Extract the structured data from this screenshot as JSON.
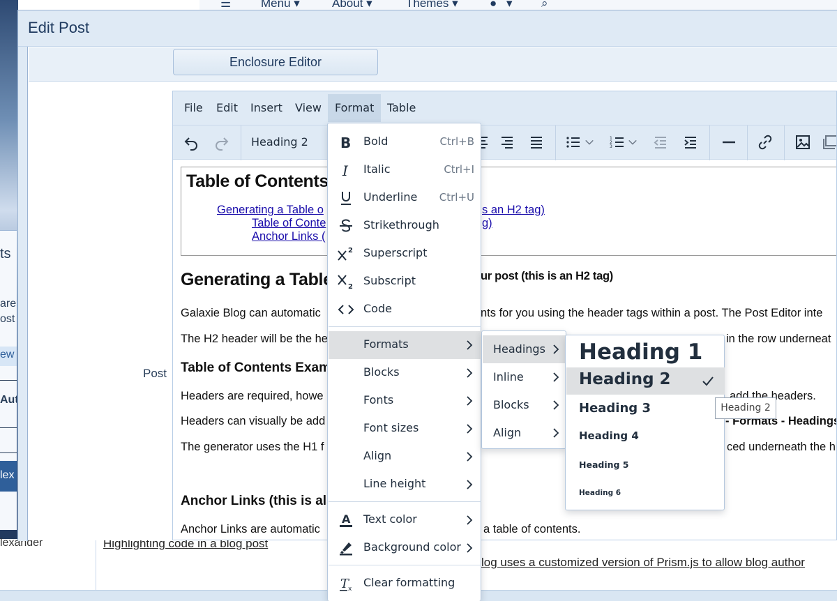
{
  "background": {
    "nav": {
      "menu": "Menu ▾",
      "about": "About ▾",
      "themes": "Themes ▾",
      "user": "▾"
    },
    "left_fragments": [
      "ts",
      "are",
      "ost",
      "ew l",
      "Aut",
      "lex"
    ],
    "author": "lexander",
    "link1": "Highlighting code in a blog post",
    "link2": "log uses a customized version of Prism.js to allow blog author"
  },
  "dialog": {
    "title": "Edit Post",
    "enclosure_button": "Enclosure Editor",
    "post_label": "Post"
  },
  "editor": {
    "menubar": [
      "File",
      "Edit",
      "Insert",
      "View",
      "Format",
      "Table"
    ],
    "active_menu": "Format",
    "toolbar": {
      "block_format": "Heading 2"
    },
    "content": {
      "toc_title": "Table of Contents",
      "toc_links": [
        "Generating a Table o",
        "s an H2 tag)",
        "Table of Conte",
        "g)",
        "Anchor Links ("
      ],
      "h2_1_a": "Generating a Table",
      "h2_1_b": "ur post (this is an H2 tag)",
      "p1_a": "Galaxie Blog can automatic",
      "p1_b": "nts for you using the header tags within a post. The Post Editor inte",
      "p2_a": "The H2 header will be the he",
      "p2_b": "in the row underneat",
      "h3_1": "Table of Contents Exam",
      "p3_a": "Headers are required, howe",
      "p3_b": "add the headers.",
      "p4_a": "Headers can visually be add",
      "p4_b": "- Formats -  Headings",
      "p5_a": "The generator uses the H1 f",
      "p5_b": "ced underneath the h",
      "h3_2": "Anchor Links (this is als",
      "p6_a": "Anchor Links are automatic",
      "p6_b": "a table of contents."
    }
  },
  "format_menu": {
    "items": [
      {
        "label": "Bold",
        "shortcut": "Ctrl+B"
      },
      {
        "label": "Italic",
        "shortcut": "Ctrl+I"
      },
      {
        "label": "Underline",
        "shortcut": "Ctrl+U"
      },
      {
        "label": "Strikethrough"
      },
      {
        "label": "Superscript"
      },
      {
        "label": "Subscript"
      },
      {
        "label": "Code"
      },
      {
        "label": "Formats"
      },
      {
        "label": "Blocks"
      },
      {
        "label": "Fonts"
      },
      {
        "label": "Font sizes"
      },
      {
        "label": "Align"
      },
      {
        "label": "Line height"
      },
      {
        "label": "Text color"
      },
      {
        "label": "Background color"
      },
      {
        "label": "Clear formatting"
      }
    ],
    "active": "Formats"
  },
  "formats_menu": {
    "items": [
      "Headings",
      "Inline",
      "Blocks",
      "Align"
    ],
    "active": "Headings"
  },
  "headings_menu": {
    "items": [
      "Heading 1",
      "Heading 2",
      "Heading 3",
      "Heading 4",
      "Heading 5",
      "Heading 6"
    ],
    "selected": "Heading 2"
  },
  "tooltip": "Heading 2",
  "colors": {
    "accent": "#dfeaf5",
    "menu_active": "#dee0e2",
    "link": "#1a0dab"
  }
}
